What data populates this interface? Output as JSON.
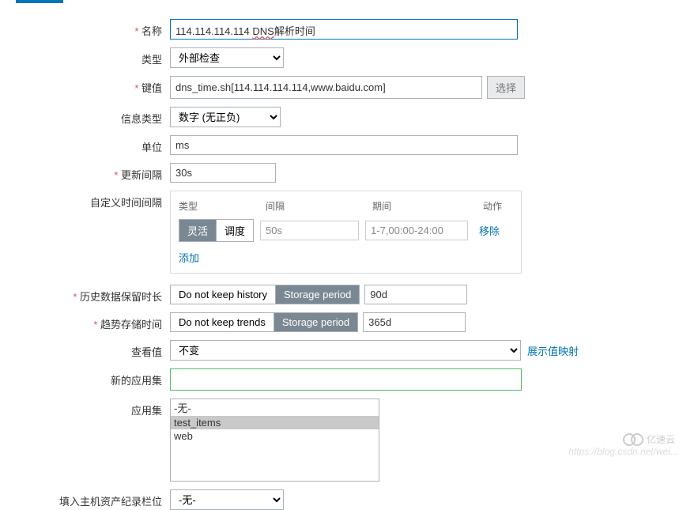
{
  "fields": {
    "name": {
      "label": "名称",
      "value": "114.114.114.114 DNS解析时间",
      "dns_part": "DNS"
    },
    "type": {
      "label": "类型",
      "value": "外部检查"
    },
    "key": {
      "label": "键值",
      "value": "dns_time.sh[114.114.114.114,www.baidu.com]",
      "select_btn": "选择"
    },
    "info_type": {
      "label": "信息类型",
      "value": "数字 (无正负)"
    },
    "unit": {
      "label": "单位",
      "value": "ms"
    },
    "update_interval": {
      "label": "更新间隔",
      "value": "30s"
    },
    "custom_interval": {
      "label": "自定义时间间隔",
      "headers": {
        "type": "类型",
        "interval": "间隔",
        "period": "期间",
        "action": "动作"
      },
      "row": {
        "flexible": "灵活",
        "schedule": "调度",
        "interval": "50s",
        "period": "1-7,00:00-24:00",
        "remove": "移除"
      },
      "add": "添加"
    },
    "history": {
      "label": "历史数据保留时长",
      "no_keep": "Do not keep history",
      "storage": "Storage period",
      "value": "90d"
    },
    "trends": {
      "label": "趋势存储时间",
      "no_keep": "Do not keep trends",
      "storage": "Storage period",
      "value": "365d"
    },
    "view_value": {
      "label": "查看值",
      "value": "不变",
      "link": "展示值映射"
    },
    "new_app": {
      "label": "新的应用集"
    },
    "app_set": {
      "label": "应用集",
      "items": [
        "-无-",
        "test_items",
        "web"
      ]
    },
    "asset_record": {
      "label": "填入主机资产纪录栏位",
      "value": "-无-"
    }
  },
  "watermark": "https://blog.csdn.net/wei...",
  "logo_text": "亿速云"
}
